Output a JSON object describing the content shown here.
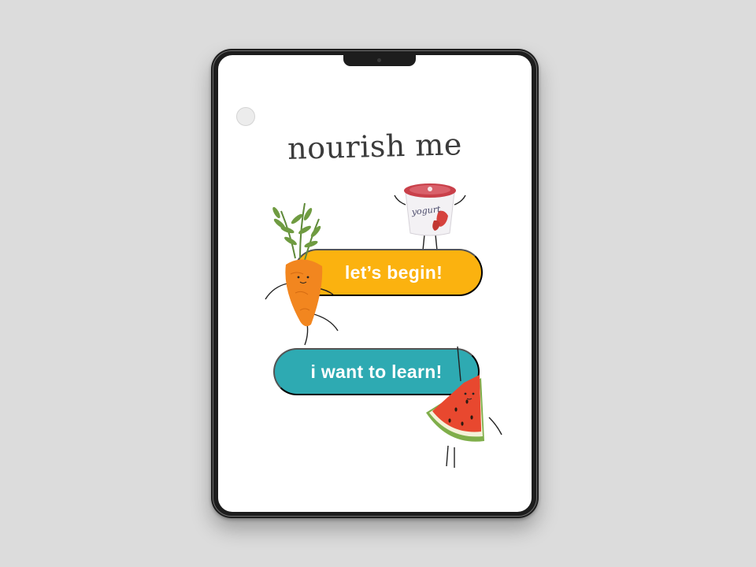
{
  "app": {
    "title": "nourish me"
  },
  "buttons": {
    "begin_label": "let’s begin!",
    "learn_label": "i want to learn!"
  },
  "illustrations": {
    "yogurt_label": "yogurt"
  },
  "colors": {
    "background": "#dcdcdc",
    "screen": "#ffffff",
    "title": "#3b3b3b",
    "begin_button": "#fbb20f",
    "learn_button": "#2eaab2",
    "carrot": "#f2861f",
    "leaves": "#5f8a3a",
    "watermelon": "#e8482f",
    "yogurt_lid": "#c9404a"
  },
  "icons": [
    "home-button-icon",
    "carrot-character-icon",
    "yogurt-character-icon",
    "watermelon-character-icon"
  ]
}
